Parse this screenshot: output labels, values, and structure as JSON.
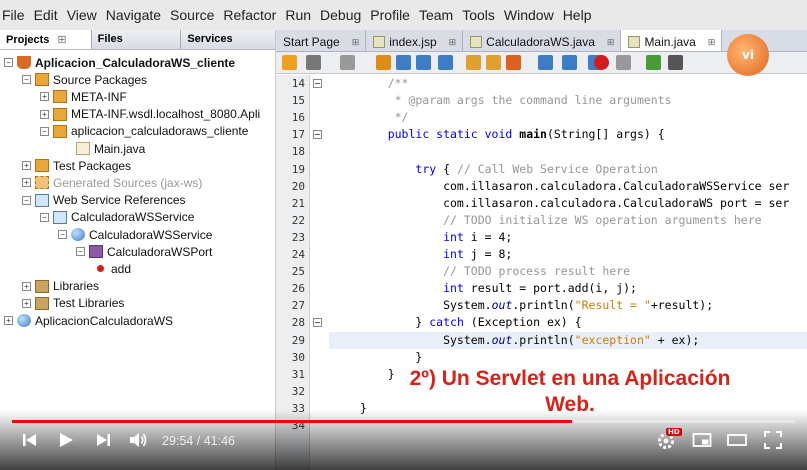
{
  "menubar": [
    "File",
    "Edit",
    "View",
    "Navigate",
    "Source",
    "Refactor",
    "Run",
    "Debug",
    "Profile",
    "Team",
    "Tools",
    "Window",
    "Help"
  ],
  "panel_tabs": [
    {
      "label": "Projects",
      "close": "⊞"
    },
    {
      "label": "Files",
      "close": ""
    },
    {
      "label": "Services",
      "close": ""
    }
  ],
  "tree": [
    {
      "label": "Aplicacion_CalculadoraWS_cliente",
      "expander": "−",
      "icon": "cup",
      "bold": true,
      "gray": false
    },
    {
      "label": "Source Packages",
      "expander": "−",
      "icon": "pkg",
      "bold": false,
      "gray": false
    },
    {
      "label": "META-INF",
      "expander": "+",
      "icon": "pkg",
      "bold": false,
      "gray": false
    },
    {
      "label": "META-INF.wsdl.localhost_8080.Apli",
      "expander": "+",
      "icon": "pkg",
      "bold": false,
      "gray": false
    },
    {
      "label": "aplicacion_calculadoraws_cliente",
      "expander": "−",
      "icon": "pkg",
      "bold": false,
      "gray": false
    },
    {
      "label": "Main.java",
      "expander": "",
      "icon": "java",
      "bold": false,
      "gray": false
    },
    {
      "label": "Test Packages",
      "expander": "+",
      "icon": "pkg",
      "bold": false,
      "gray": false
    },
    {
      "label": "Generated Sources (jax-ws)",
      "expander": "+",
      "icon": "pkgf",
      "bold": false,
      "gray": true
    },
    {
      "label": "Web Service References",
      "expander": "−",
      "icon": "svc",
      "bold": false,
      "gray": false
    },
    {
      "label": "CalculadoraWSService",
      "expander": "−",
      "icon": "svc",
      "bold": false,
      "gray": false
    },
    {
      "label": "CalculadoraWSService",
      "expander": "−",
      "icon": "globe",
      "bold": false,
      "gray": false
    },
    {
      "label": "CalculadoraWSPort",
      "expander": "−",
      "icon": "port",
      "bold": false,
      "gray": false
    },
    {
      "label": "add",
      "expander": "",
      "icon": "dot",
      "bold": false,
      "gray": false
    },
    {
      "label": "Libraries",
      "expander": "+",
      "icon": "jar",
      "bold": false,
      "gray": false
    },
    {
      "label": "Test Libraries",
      "expander": "+",
      "icon": "jar",
      "bold": false,
      "gray": false
    },
    {
      "label": "AplicacionCalculadoraWS",
      "expander": "+",
      "icon": "globe",
      "bold": false,
      "gray": false
    }
  ],
  "editor_tabs": [
    {
      "label": "Start Page",
      "close": "⊞"
    },
    {
      "label": "index.jsp",
      "close": "⊞"
    },
    {
      "label": "CalculadoraWS.java",
      "close": "⊞"
    },
    {
      "label": "Main.java",
      "close": "⊞"
    }
  ],
  "line_numbers": [
    "14",
    "15",
    "16",
    "17",
    "18",
    "19",
    "20",
    "21",
    "22",
    "23",
    "24",
    "25",
    "26",
    "27",
    "28",
    "29",
    "30",
    "31",
    "32",
    "33",
    "34"
  ],
  "code_lines": [
    [
      {
        "t": "    /**",
        "c": "c"
      }
    ],
    [
      {
        "t": "     * @param args the command line arguments",
        "c": "c"
      }
    ],
    [
      {
        "t": "     */",
        "c": "c"
      }
    ],
    [
      {
        "t": "    ",
        "c": ""
      },
      {
        "t": "public static void ",
        "c": "k"
      },
      {
        "t": "main",
        "c": "m"
      },
      {
        "t": "(String[] args) {",
        "c": ""
      }
    ],
    [],
    [
      {
        "t": "        ",
        "c": ""
      },
      {
        "t": "try",
        "c": "k"
      },
      {
        "t": " { ",
        "c": ""
      },
      {
        "t": "// Call Web Service Operation",
        "c": "c"
      }
    ],
    [
      {
        "t": "            com.illasaron.calculadora.CalculadoraWSService ser",
        "c": ""
      }
    ],
    [
      {
        "t": "            com.illasaron.calculadora.CalculadoraWS port = ser",
        "c": ""
      }
    ],
    [
      {
        "t": "            ",
        "c": ""
      },
      {
        "t": "// TODO initialize WS operation arguments here",
        "c": "c"
      }
    ],
    [
      {
        "t": "            ",
        "c": ""
      },
      {
        "t": "int",
        "c": "k"
      },
      {
        "t": " i = 4;",
        "c": ""
      }
    ],
    [
      {
        "t": "            ",
        "c": ""
      },
      {
        "t": "int",
        "c": "k"
      },
      {
        "t": " j = 8;",
        "c": ""
      }
    ],
    [
      {
        "t": "            ",
        "c": ""
      },
      {
        "t": "// TODO process result here",
        "c": "c"
      }
    ],
    [
      {
        "t": "            ",
        "c": ""
      },
      {
        "t": "int",
        "c": "k"
      },
      {
        "t": " result = port.add(i, j);",
        "c": ""
      }
    ],
    [
      {
        "t": "            System.",
        "c": ""
      },
      {
        "t": "out",
        "c": "i"
      },
      {
        "t": ".println(",
        "c": ""
      },
      {
        "t": "\"Result = \"",
        "c": "s"
      },
      {
        "t": "+result);",
        "c": ""
      }
    ],
    [
      {
        "t": "        } ",
        "c": ""
      },
      {
        "t": "catch",
        "c": "k"
      },
      {
        "t": " (Exception ex) {",
        "c": ""
      }
    ],
    [
      {
        "t": "            System.",
        "c": ""
      },
      {
        "t": "out",
        "c": "i"
      },
      {
        "t": ".println(",
        "c": ""
      },
      {
        "t": "\"exception\"",
        "c": "s"
      },
      {
        "t": " + ex);",
        "c": ""
      }
    ],
    [
      {
        "t": "        }",
        "c": ""
      }
    ],
    [
      {
        "t": "    }",
        "c": ""
      }
    ],
    [],
    [
      {
        "t": "}",
        "c": ""
      }
    ],
    []
  ],
  "logo_text": "vi",
  "caption": [
    "2º) Un Servlet en una Aplicación",
    "Web."
  ],
  "player": {
    "time": "29:54 / 41:46",
    "progress": 0.715,
    "hd": "HD"
  }
}
